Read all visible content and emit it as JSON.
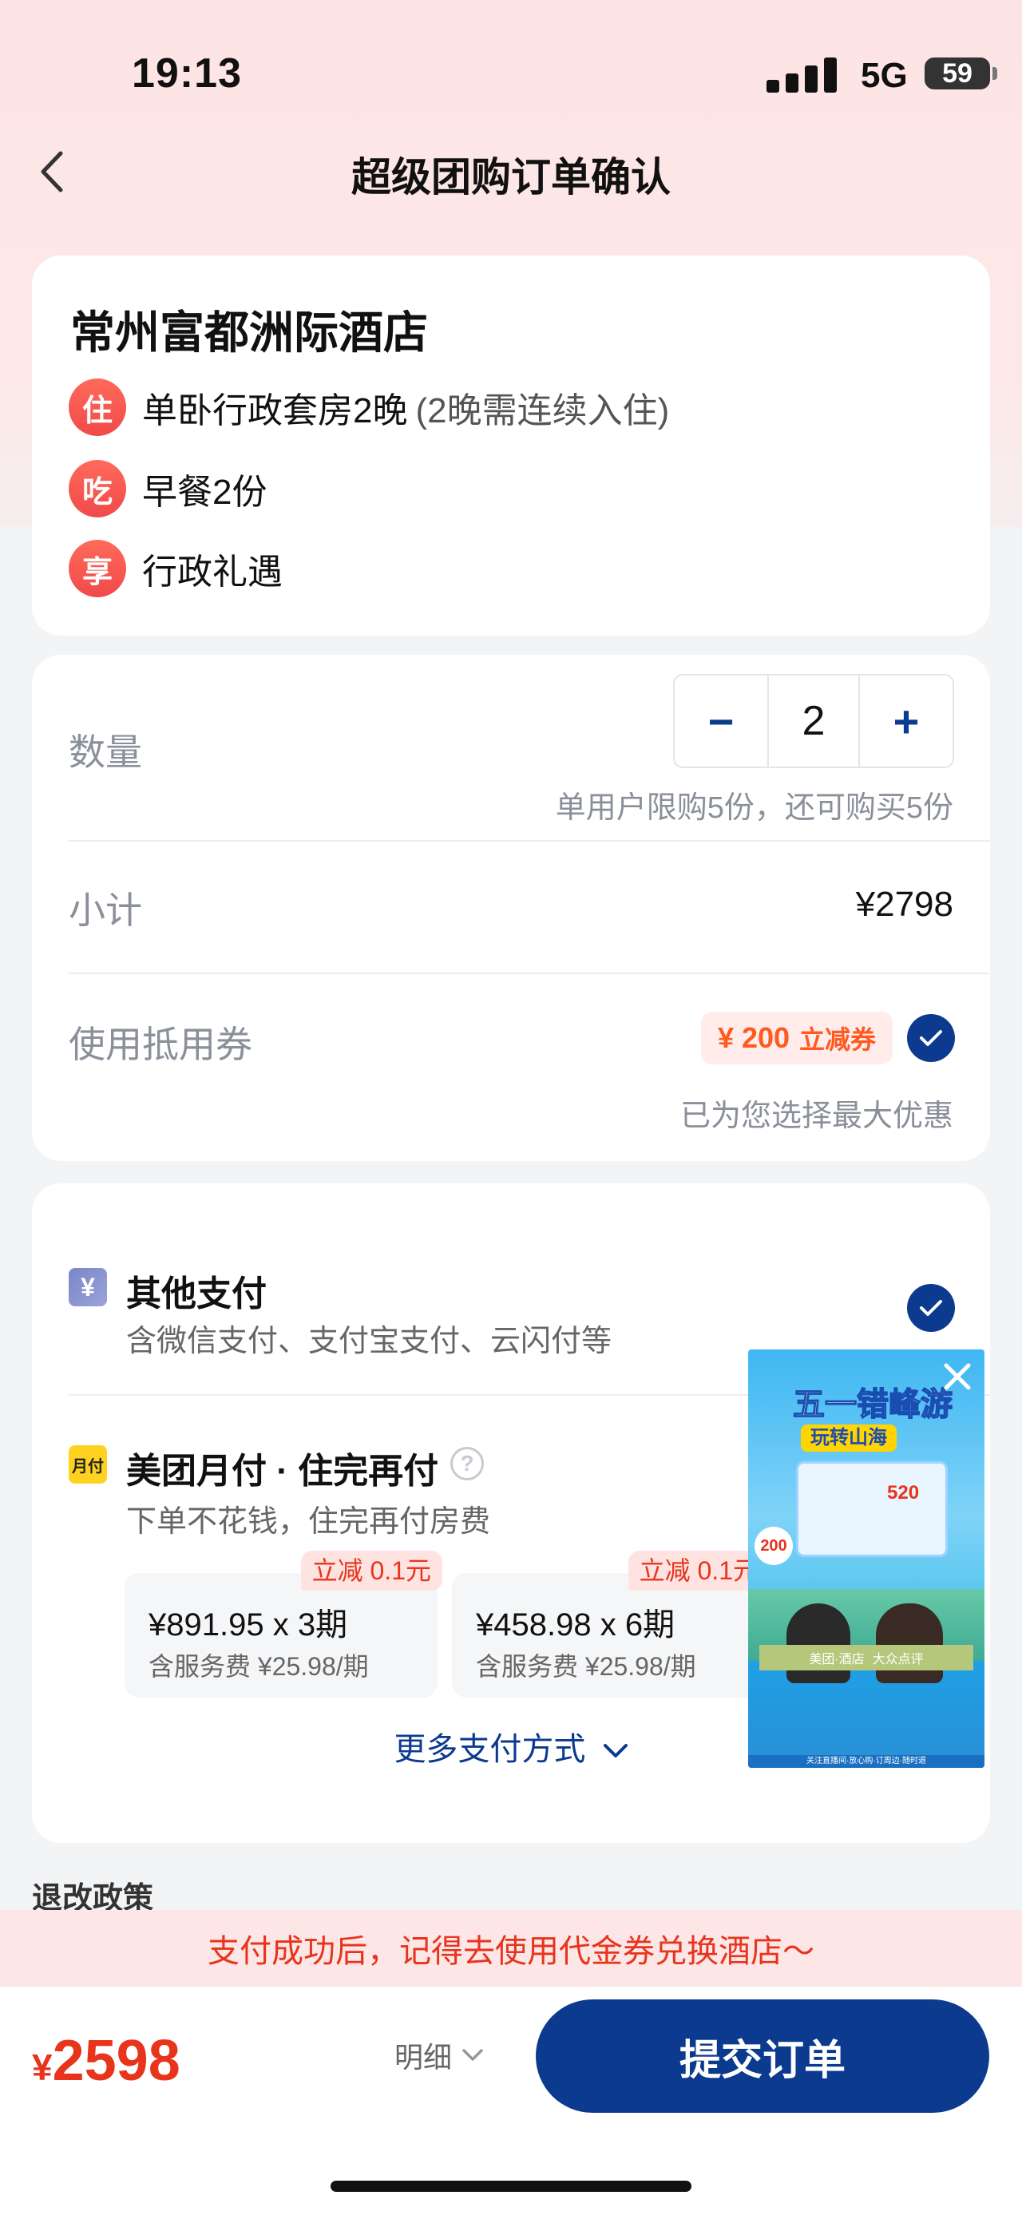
{
  "status_bar": {
    "time": "19:13",
    "network": "5G",
    "battery": "59"
  },
  "nav": {
    "title": "超级团购订单确认"
  },
  "hotel": {
    "name": "常州富都洲际酒店",
    "features": [
      {
        "badge": "住",
        "text": "单卧行政套房2晚",
        "note": "(2晚需连续入住)"
      },
      {
        "badge": "吃",
        "text": "早餐2份",
        "note": ""
      },
      {
        "badge": "享",
        "text": "行政礼遇",
        "note": ""
      }
    ]
  },
  "order": {
    "quantity_label": "数量",
    "quantity_value": "2",
    "minus": "−",
    "plus": "+",
    "limit_hint": "单用户限购5份，还可购买5份",
    "subtotal_label": "小计",
    "subtotal_value": "¥2798",
    "coupon_label": "使用抵用券",
    "coupon_amount": "¥ 200",
    "coupon_type": "立减券",
    "coupon_hint": "已为您选择最大优惠"
  },
  "payment": {
    "other": {
      "icon": "¥",
      "title": "其他支付",
      "subtitle": "含微信支付、支付宝支付、云闪付等"
    },
    "monthly": {
      "icon": "月付",
      "title": "美团月付 · 住完再付",
      "subtitle": "下单不花钱，住完再付房费",
      "plans": [
        {
          "tag": "立减 0.1元",
          "price": "¥891.95 x 3期",
          "fee": "含服务费 ¥25.98/期"
        },
        {
          "tag": "立减 0.1元",
          "price": "¥458.98 x 6期",
          "fee": "含服务费 ¥25.98/期"
        }
      ]
    },
    "more": "更多支付方式"
  },
  "policy": {
    "title": "退改政策"
  },
  "tip": "支付成功后，记得去使用代金券兑换酒店～",
  "bottom_bar": {
    "currency": "¥",
    "total": "2598",
    "detail": "明细",
    "submit": "提交订单"
  },
  "ad": {
    "headline": "五一错峰游",
    "sub": "玩转山海",
    "brand": "美团·酒店",
    "brand2": "大众点评",
    "tag": "520",
    "price_tag": "200",
    "footer": "关注直播间·放心购·订周边·随时退"
  }
}
